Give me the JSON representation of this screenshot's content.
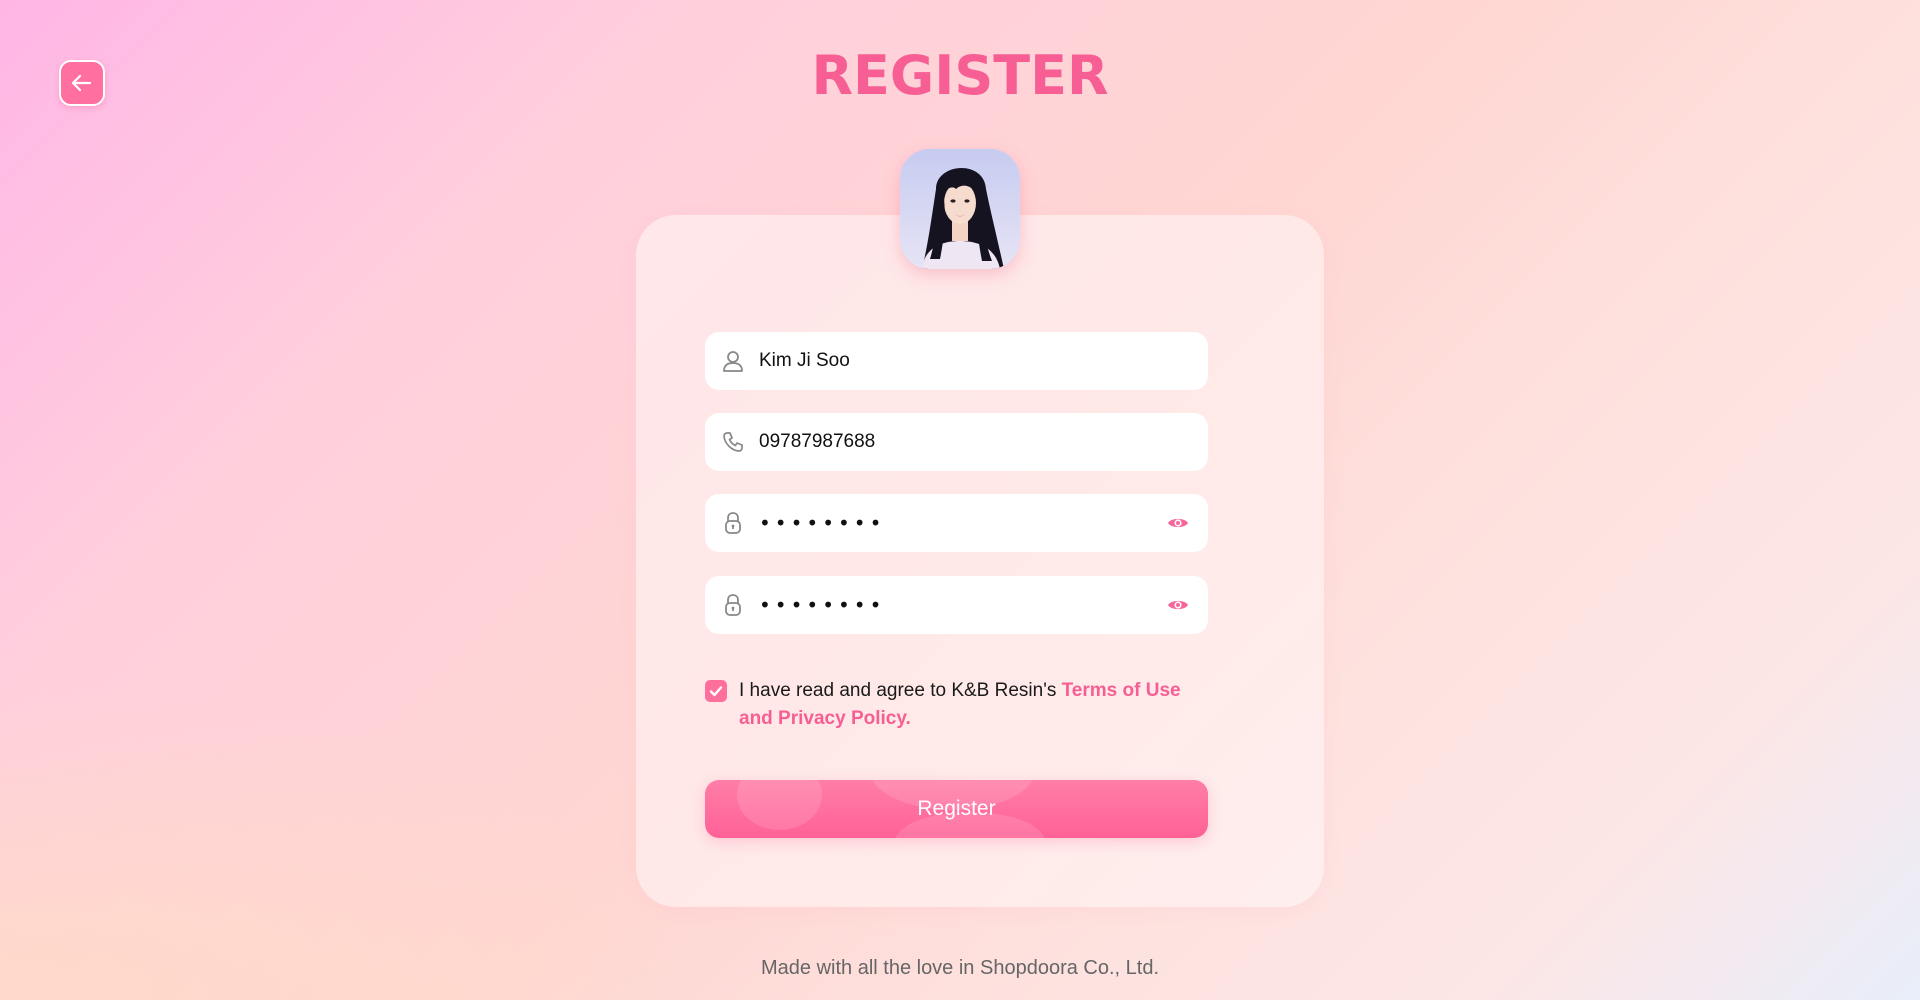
{
  "header": {
    "title": "REGISTER",
    "back_icon": "arrow-left-icon"
  },
  "profile": {
    "avatar_icon": "profile-photo"
  },
  "form": {
    "name": {
      "value": "Kim Ji Soo",
      "icon": "user-icon"
    },
    "phone": {
      "value": "09787987688",
      "icon": "phone-icon"
    },
    "password": {
      "value": "••••••••",
      "icon": "lock-icon",
      "toggle_icon": "eye-icon"
    },
    "confirm_password": {
      "value": "••••••••",
      "icon": "lock-icon",
      "toggle_icon": "eye-icon"
    },
    "agree": {
      "checked": true,
      "text": "I have read and agree to K&B Resin's ",
      "link": "Terms of Use and Privacy Policy."
    },
    "submit_label": "Register"
  },
  "footer": {
    "text": "Made with all the love in Shopdoora Co., Ltd."
  },
  "colors": {
    "accent": "#f75f94",
    "button": "#ff6f9c",
    "field_bg": "#ffffff"
  }
}
